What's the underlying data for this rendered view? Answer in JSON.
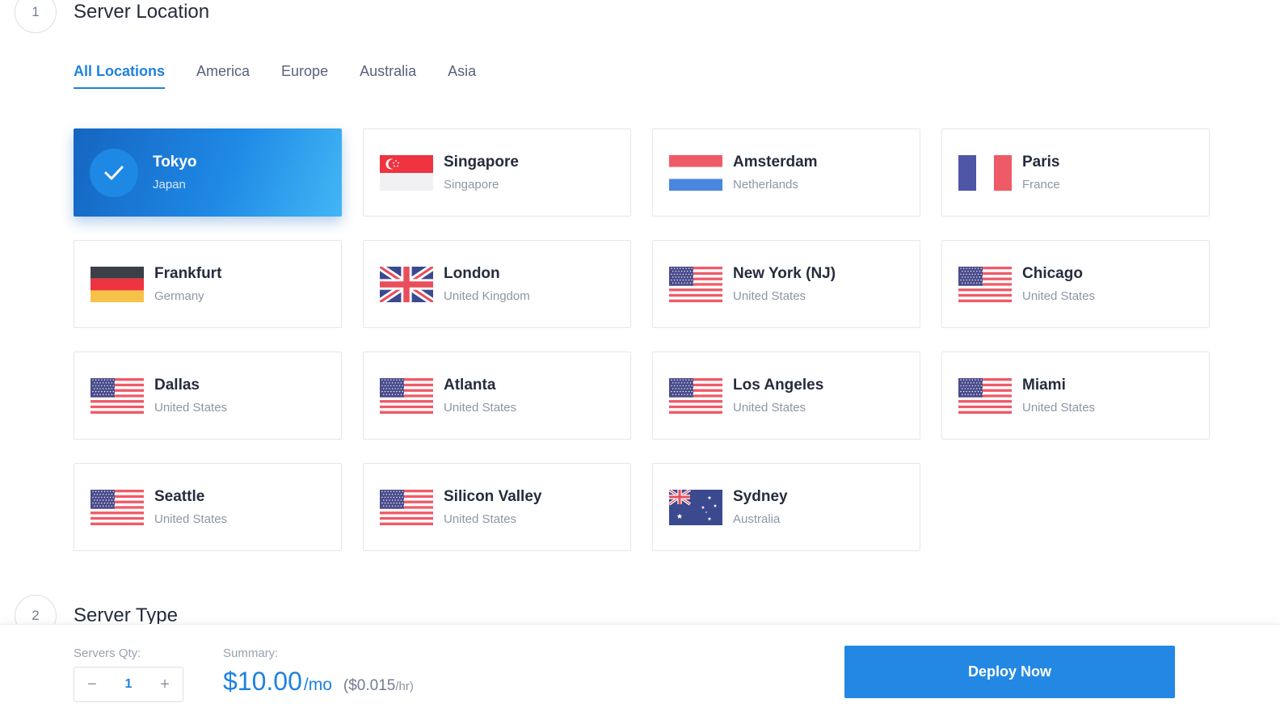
{
  "step1": {
    "number": "1",
    "title": "Server Location"
  },
  "step2": {
    "number": "2",
    "title": "Server Type"
  },
  "tabs": [
    "All Locations",
    "America",
    "Europe",
    "Australia",
    "Asia"
  ],
  "active_tab": "All Locations",
  "locations": [
    {
      "city": "Tokyo",
      "country": "Japan",
      "flag": "japan-flag",
      "selected": true
    },
    {
      "city": "Singapore",
      "country": "Singapore",
      "flag": "singapore-flag"
    },
    {
      "city": "Amsterdam",
      "country": "Netherlands",
      "flag": "netherlands-flag"
    },
    {
      "city": "Paris",
      "country": "France",
      "flag": "france-flag"
    },
    {
      "city": "Frankfurt",
      "country": "Germany",
      "flag": "germany-flag"
    },
    {
      "city": "London",
      "country": "United Kingdom",
      "flag": "uk-flag"
    },
    {
      "city": "New York (NJ)",
      "country": "United States",
      "flag": "us-flag"
    },
    {
      "city": "Chicago",
      "country": "United States",
      "flag": "us-flag"
    },
    {
      "city": "Dallas",
      "country": "United States",
      "flag": "us-flag"
    },
    {
      "city": "Atlanta",
      "country": "United States",
      "flag": "us-flag"
    },
    {
      "city": "Los Angeles",
      "country": "United States",
      "flag": "us-flag"
    },
    {
      "city": "Miami",
      "country": "United States",
      "flag": "us-flag"
    },
    {
      "city": "Seattle",
      "country": "United States",
      "flag": "us-flag"
    },
    {
      "city": "Silicon Valley",
      "country": "United States",
      "flag": "us-flag"
    },
    {
      "city": "Sydney",
      "country": "Australia",
      "flag": "australia-flag"
    }
  ],
  "footer": {
    "qty_label": "Servers Qty:",
    "qty_value": "1",
    "minus": "−",
    "plus": "+",
    "summary_label": "Summary:",
    "price": "$10.00",
    "price_period": "/mo",
    "hourly": "($0.015",
    "hourly_unit": "/hr)",
    "deploy_label": "Deploy Now"
  },
  "colors": {
    "accent": "#1e82e0",
    "selected_gradient_start": "#1565c0",
    "selected_gradient_end": "#42b6f5"
  }
}
